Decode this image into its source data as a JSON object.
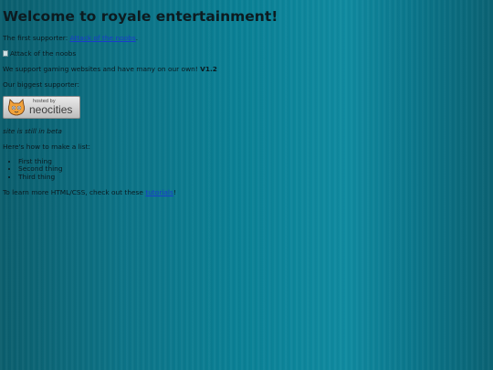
{
  "heading": "Welcome to royale entertainment!",
  "supporter": {
    "prefix": "The first supporter: ",
    "link": "Attack of the noobs",
    "suffix": "."
  },
  "image_alt": "Attack of the noobs",
  "support_line": {
    "text": "We support gaming websites and have many on our own! ",
    "version": "V1.2"
  },
  "biggest_supporter": "Our biggest supporter:",
  "badge": {
    "small": "hosted by",
    "big": "neocities",
    "icon": "neocities-cat-icon"
  },
  "beta_note": "site is still in beta",
  "list_intro": "Here's how to make a list:",
  "list_items": [
    "First thing",
    "Second thing",
    "Third thing"
  ],
  "learn_more": {
    "prefix": "To learn more HTML/CSS, check out these ",
    "link": "tutorials",
    "suffix": "!"
  }
}
